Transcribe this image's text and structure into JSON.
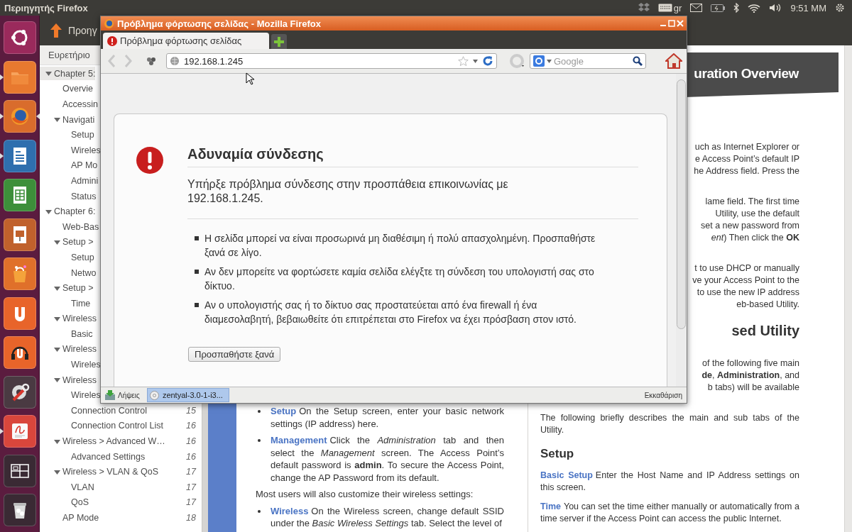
{
  "top_panel": {
    "title": "Περιηγητής Firefox",
    "keyboard_layout": "gr",
    "clock": "9:51 ΜΜ"
  },
  "launcher": {
    "items": [
      {
        "kind": "ubuntu",
        "running": false,
        "focused": false
      },
      {
        "kind": "folder",
        "running": true,
        "focused": false
      },
      {
        "kind": "browser",
        "running": true,
        "focused": true
      },
      {
        "kind": "writer",
        "running": true,
        "focused": false
      },
      {
        "kind": "calc",
        "running": false,
        "focused": false
      },
      {
        "kind": "impress",
        "running": false,
        "focused": false
      },
      {
        "kind": "bag",
        "running": false,
        "focused": false
      },
      {
        "kind": "uapp",
        "running": false,
        "focused": false
      },
      {
        "kind": "headphones",
        "running": false,
        "focused": false
      },
      {
        "kind": "settings",
        "running": false,
        "focused": false
      },
      {
        "kind": "viewer",
        "running": true,
        "focused": false
      },
      {
        "kind": "workspaces",
        "running": false,
        "focused": false
      },
      {
        "kind": "trash",
        "running": false,
        "focused": false
      }
    ]
  },
  "document_viewer": {
    "back_label": "Προηγ",
    "sidebar": {
      "title": "Ευρετήριο",
      "tree": [
        {
          "label": "Chapter 5:",
          "selected": true,
          "expanded": true,
          "children": [
            {
              "label": "Overvie",
              "selected": false
            },
            {
              "label": "Accessin",
              "selected": false
            },
            {
              "label": "Navigati",
              "selected": false,
              "expanded": true,
              "children": [
                {
                  "label": "Setup",
                  "selected": false
                },
                {
                  "label": "Wireles",
                  "selected": false
                },
                {
                  "label": "AP Mo",
                  "selected": false
                },
                {
                  "label": "Admini",
                  "selected": false
                },
                {
                  "label": "Status",
                  "selected": false
                }
              ]
            }
          ]
        },
        {
          "label": "Chapter 6:",
          "selected": false,
          "expanded": true,
          "children": [
            {
              "label": "Web-Bas",
              "selected": false
            },
            {
              "label": "Setup >",
              "selected": false,
              "expanded": true,
              "children": [
                {
                  "label": "Setup",
                  "selected": false
                },
                {
                  "label": "Netwo",
                  "selected": false
                }
              ]
            },
            {
              "label": "Setup >",
              "selected": false,
              "expanded": true,
              "children": [
                {
                  "label": "Time",
                  "selected": false
                }
              ]
            },
            {
              "label": "Wireless",
              "selected": false,
              "expanded": true,
              "children": [
                {
                  "label": "Basic",
                  "selected": false
                }
              ]
            },
            {
              "label": "Wireless",
              "selected": false,
              "expanded": true,
              "children": [
                {
                  "label": "Wireles",
                  "selected": false
                }
              ]
            },
            {
              "label": "Wireless",
              "selected": false,
              "expanded": true,
              "children": [
                {
                  "label": "Wireles",
                  "selected": false
                },
                {
                  "label": "Connection Control",
                  "page": "15",
                  "selected": false
                },
                {
                  "label": "Connection Control List",
                  "page": "16",
                  "selected": false
                }
              ]
            },
            {
              "label": "Wireless > Advanced W…",
              "page": "16",
              "selected": false,
              "expanded": true,
              "children": [
                {
                  "label": "Advanced Settings",
                  "page": "16",
                  "selected": false
                }
              ]
            },
            {
              "label": "Wireless > VLAN & QoS",
              "page": "17",
              "selected": false,
              "expanded": true,
              "children": [
                {
                  "label": "VLAN",
                  "page": "17",
                  "selected": false
                },
                {
                  "label": "QoS",
                  "page": "17",
                  "selected": false
                }
              ]
            },
            {
              "label": "AP Mode",
              "page": "18",
              "selected": false
            }
          ]
        }
      ]
    },
    "left_page": {
      "blocks": [
        {
          "kind": "bullet",
          "term": "Setup",
          "text": "On the Setup screen, enter your basic network settings (IP address) here."
        },
        {
          "kind": "bullet",
          "term": "Management",
          "text": "Click the *Administration* tab and then select the *Management* screen. The Access Point’s default password is **admin**. To secure the Access Point, change the AP Password from its default."
        },
        {
          "kind": "plain",
          "text": "Most users will also customize their wireless settings:"
        },
        {
          "kind": "bullet",
          "term": "Wireless",
          "text": "On the Wireless screen, change default SSID under the *Basic Wireless Settings* tab. Select the level of"
        }
      ]
    },
    "right_page": {
      "banner": "uration Overview",
      "blocks": [
        {
          "kind": "fragment",
          "lines": [
            "uch as Internet Explorer or",
            "e Access Point’s default IP",
            "he Address field. Press the"
          ]
        },
        {
          "kind": "fragment",
          "lines": [
            "lame field. The first time",
            "Utility, use the default",
            "set a new password from",
            "*ent*) Then click the **OK**"
          ]
        },
        {
          "kind": "fragment",
          "lines": [
            "t to use DHCP or manually",
            "ve your Access Point to the",
            "to use the new IP address",
            "eb-based Utility."
          ]
        },
        {
          "kind": "heading_fragment",
          "text": "sed Utility"
        },
        {
          "kind": "fragment",
          "lines": [
            "of the following five main",
            "**de**, **Administration**, and",
            "b tabs) will be available"
          ]
        },
        {
          "kind": "paragraph",
          "text": "The following briefly describes the main and sub tabs of the Utility."
        },
        {
          "kind": "heading",
          "text": "Setup"
        },
        {
          "kind": "term",
          "term": "Basic Setup",
          "text": "Enter the Host Name and IP Address settings on this screen."
        },
        {
          "kind": "term",
          "term": "Time",
          "text": "You can set the time either manually or automatically from a time server if the Access Point can access the public Internet."
        }
      ]
    }
  },
  "firefox": {
    "title": "Πρόβλημα φόρτωσης σελίδας - Mozilla Firefox",
    "tabs": [
      {
        "label": "Πρόβλημα φόρτωσης σελίδας",
        "selected": true
      }
    ],
    "back_disabled": true,
    "forward_disabled": true,
    "url": "192.168.1.245",
    "search_placeholder": "Google",
    "error": {
      "title": "Αδυναμία σύνδεσης",
      "message": "Υπήρξε πρόβλημα σύνδεσης στην προσπάθεια επικοινωνίας με 192.168.1.245.",
      "bullets": [
        "Η σελίδα μπορεί να είναι προσωρινά μη διαθέσιμη ή πολύ απασχολημένη. Προσπαθήστε ξανά σε λίγο.",
        "Αν δεν μπορείτε να φορτώσετε καμία σελίδα ελέγξτε τη σύνδεση του υπολογιστή σας στο δίκτυο.",
        "Αν ο υπολογιστής σας ή το δίκτυο σας προστατεύεται από ένα firewall ή ένα διαμεσολαβητή, βεβαιωθείτε ότι επιτρέπεται στο Firefox να έχει πρόσβαση στον ιστό."
      ],
      "button": "Προσπαθήστε ξανά"
    },
    "status_bar": {
      "downloads_label": "Λήψεις",
      "download_item": "zentyal-3.0-1-i3...",
      "clear_label": "Εκκαθάριση"
    }
  }
}
